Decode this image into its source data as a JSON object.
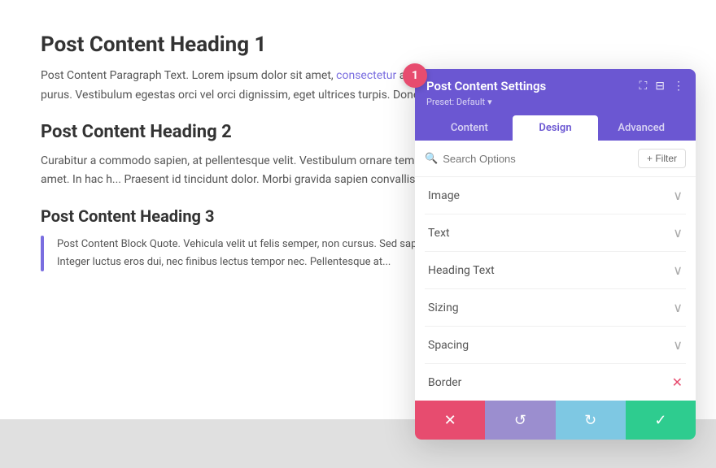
{
  "page": {
    "background": "#ffffff"
  },
  "content": {
    "heading1": "Post Content Heading 1",
    "paragraph1": "Post Content Paragraph Text. Lorem ipsum dolor sit amet, consectetur adipiscing elit. Nullam vitae congue libero, nec finibus purus. Vestibulum egestas orci vel orci dignissim, eget ultrices turpis. Donec sit amet rhoncus erat. Phasellus volutpat v...",
    "paragraph1_link": "consectetur",
    "heading2": "Post Content Heading 2",
    "paragraph2": "Curabitur a commodo sapien, at pellentesque velit. Vestibulum ornare tempus massa orci, vitae lacinia tortor maximus sit amet. In hac h... Praesent id tincidunt dolor. Morbi gravida sapien convallis sapien...",
    "heading3": "Post Content Heading 3",
    "blockquote": "Post Content Block Quote. Vehicula velit ut felis semper, non cursus. Sed sapien nisl, tempus ut semper sed, congue quis leo. Integer luctus eros dui, nec finibus lectus tempor nec. Pellentesque at..."
  },
  "panel": {
    "title": "Post Content Settings",
    "preset_label": "Preset: Default",
    "tabs": [
      {
        "id": "content",
        "label": "Content"
      },
      {
        "id": "design",
        "label": "Design"
      },
      {
        "id": "advanced",
        "label": "Advanced"
      }
    ],
    "active_tab": "design",
    "search_placeholder": "Search Options",
    "filter_label": "+ Filter",
    "sections": [
      {
        "label": "Image"
      },
      {
        "label": "Text"
      },
      {
        "label": "Heading Text"
      },
      {
        "label": "Sizing"
      },
      {
        "label": "Spacing"
      },
      {
        "label": "Border"
      }
    ],
    "toolbar": {
      "cancel": "✕",
      "undo": "↺",
      "redo": "↻",
      "save": "✓"
    }
  },
  "badge": {
    "number": "1"
  },
  "icons": {
    "expand": "⛶",
    "columns": "⊞",
    "more": "⋮",
    "chevron_down": "∨",
    "search": "🔍"
  }
}
